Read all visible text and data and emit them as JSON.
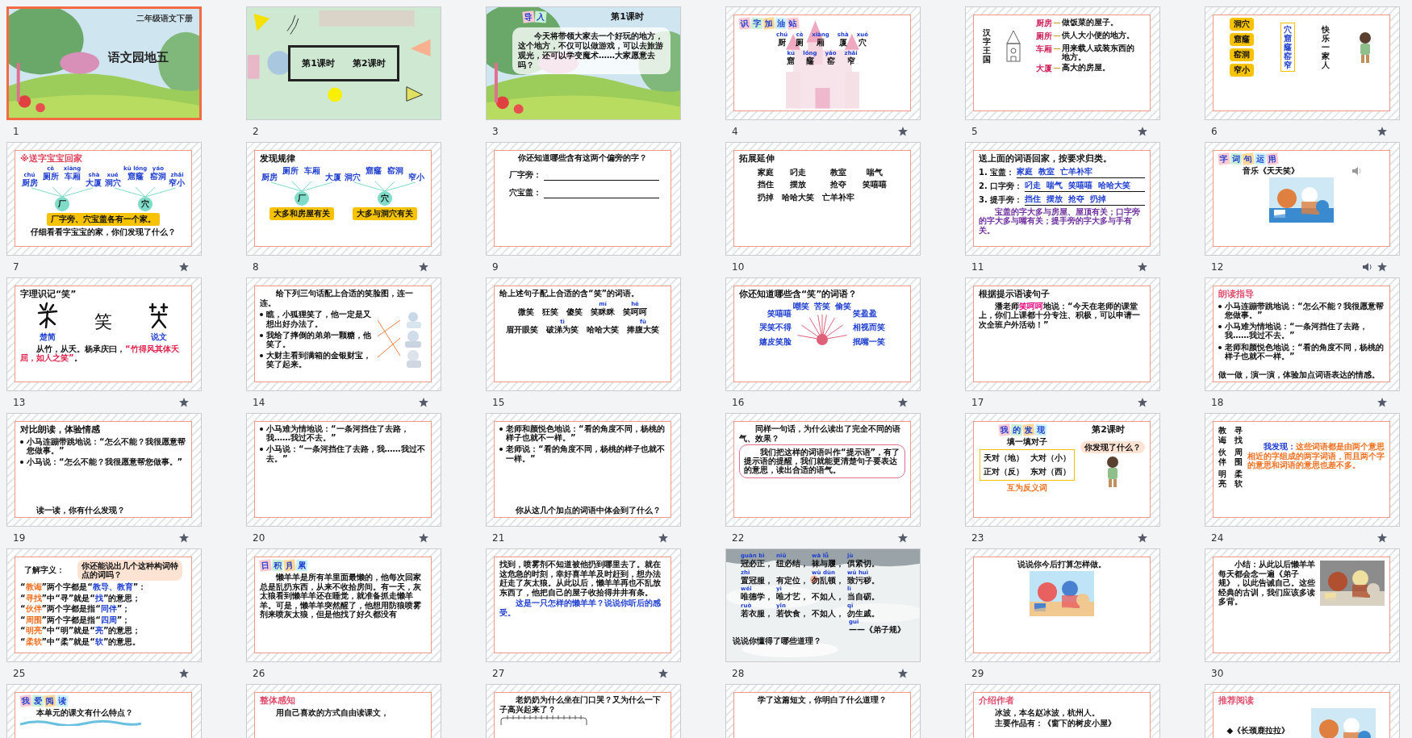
{
  "slides": [
    {
      "number": "1",
      "selected": true,
      "transition": false,
      "audio": false,
      "kind": "landscape",
      "blocks": [
        {
          "kind": "corner",
          "text": "二年级语文下册"
        },
        {
          "kind": "headline",
          "text": "语文园地五"
        }
      ]
    },
    {
      "number": "2",
      "selected": false,
      "transition": false,
      "audio": false,
      "kind": "shapes",
      "blocks": [
        {
          "kind": "lessons",
          "items": [
            "第1课时",
            "第2课时"
          ]
        }
      ]
    },
    {
      "number": "3",
      "selected": false,
      "transition": false,
      "audio": false,
      "kind": "landscape",
      "blocks": [
        {
          "kind": "row",
          "children": [
            {
              "kind": "tag",
              "text": "导入"
            },
            {
              "kind": "title",
              "text": "第1课时"
            }
          ]
        },
        {
          "kind": "panel",
          "text": "今天将带领大家去一个好玩的地方，这个地方，不仅可以做游戏，可以去旅游观光，还可以学变魔术……大家愿意去吗？"
        }
      ]
    },
    {
      "number": "4",
      "selected": false,
      "transition": true,
      "audio": false,
      "kind": "castle",
      "blocks": [
        {
          "kind": "tag",
          "text": "识字加油站"
        },
        {
          "kind": "words",
          "rows": [
            [
              {
                "pinyin": "chú",
                "text": "厨"
              },
              {
                "pinyin": "cè",
                "text": "厕"
              },
              {
                "pinyin": "xiāng",
                "text": "厢"
              },
              {
                "pinyin": "shà",
                "text": "厦"
              },
              {
                "pinyin": "xué",
                "text": "穴"
              }
            ]
          ]
        },
        {
          "kind": "words",
          "rows": [
            [
              {
                "pinyin": "kū",
                "text": "窟"
              },
              {
                "pinyin": "lóng",
                "text": "窿"
              },
              {
                "pinyin": "yáo",
                "text": "窑"
              },
              {
                "pinyin": "zhǎi",
                "text": "窄"
              }
            ]
          ]
        }
      ]
    },
    {
      "number": "5",
      "selected": false,
      "transition": true,
      "audio": false,
      "kind": "framed",
      "blocks": [
        {
          "kind": "row",
          "children": [
            {
              "kind": "vertical",
              "text": "汉字王国"
            },
            {
              "kind": "castle"
            },
            {
              "kind": "gloss",
              "items": [
                {
                  "head": "厨房",
                  "def": "做饭菜的屋子。"
                },
                {
                  "head": "厕所",
                  "def": "供人大小便的地方。"
                },
                {
                  "head": "车厢",
                  "def": "用来载人或装东西的地方。"
                },
                {
                  "head": "大厦",
                  "def": "高大的房屋。"
                }
              ]
            }
          ]
        }
      ]
    },
    {
      "number": "6",
      "selected": false,
      "transition": true,
      "audio": false,
      "kind": "framed",
      "blocks": [
        {
          "kind": "row",
          "children": [
            {
              "kind": "boxes",
              "items": [
                "洞穴",
                "窟窿",
                "窑洞",
                "窄小"
              ]
            },
            {
              "kind": "vbox",
              "text": "穴窟窿窑窄"
            },
            {
              "kind": "vertical",
              "text": "快乐一家人"
            },
            {
              "kind": "figure"
            }
          ]
        }
      ]
    },
    {
      "number": "7",
      "selected": false,
      "transition": true,
      "audio": false,
      "kind": "framed",
      "blocks": [
        {
          "kind": "title",
          "text": "※送字宝宝回家",
          "color": "#e0405a"
        },
        {
          "kind": "hubs",
          "groups": [
            {
              "center": "厂",
              "words": [
                {
                  "pinyin": "chú",
                  "text": "厨房"
                },
                {
                  "pinyin": "cè",
                  "text": "厕所"
                },
                {
                  "pinyin": "xiāng",
                  "text": "车厢"
                },
                {
                  "pinyin": "shà",
                  "text": "大厦"
                }
              ]
            },
            {
              "center": "穴",
              "words": [
                {
                  "pinyin": "xué",
                  "text": "洞穴"
                },
                {
                  "pinyin": "kū lóng",
                  "text": "窟窿"
                },
                {
                  "pinyin": "yáo",
                  "text": "窑洞"
                },
                {
                  "pinyin": "zhǎi",
                  "text": "窄小"
                }
              ]
            }
          ]
        },
        {
          "kind": "banners",
          "items": [
            "厂字旁、穴宝盖各有一个家。"
          ]
        },
        {
          "kind": "center",
          "text": "仔细看看字宝宝的家，你们发现了什么？"
        }
      ]
    },
    {
      "number": "8",
      "selected": false,
      "transition": true,
      "audio": false,
      "kind": "framed",
      "blocks": [
        {
          "kind": "title",
          "text": "发现规律"
        },
        {
          "kind": "hubs",
          "groups": [
            {
              "center": "厂",
              "words": [
                {
                  "text": "厨房"
                },
                {
                  "text": "厕所"
                },
                {
                  "text": "车厢"
                },
                {
                  "text": "大厦"
                }
              ]
            },
            {
              "center": "穴",
              "words": [
                {
                  "text": "洞穴"
                },
                {
                  "text": "窟窿"
                },
                {
                  "text": "窑洞"
                },
                {
                  "text": "窄小"
                }
              ]
            }
          ]
        },
        {
          "kind": "banners",
          "items": [
            "大多和房屋有关",
            "大多与洞穴有关"
          ]
        }
      ]
    },
    {
      "number": "9",
      "selected": false,
      "transition": false,
      "audio": false,
      "kind": "framed",
      "blocks": [
        {
          "kind": "center",
          "text": "你还知道哪些含有这两个偏旁的字？"
        },
        {
          "kind": "fill",
          "items": [
            "厂字旁：",
            "穴宝盖："
          ]
        }
      ]
    },
    {
      "number": "10",
      "selected": false,
      "transition": false,
      "audio": false,
      "kind": "framed",
      "blocks": [
        {
          "kind": "title",
          "text": "拓展延伸"
        },
        {
          "kind": "words",
          "rows": [
            [
              {
                "text": "家庭"
              },
              {
                "text": "叼走"
              },
              {
                "text": "教室"
              },
              {
                "text": "喘气"
              }
            ],
            [
              {
                "text": "挡住"
              },
              {
                "text": "摆放"
              },
              {
                "text": "抢夺"
              },
              {
                "text": "笑嘻嘻"
              }
            ],
            [
              {
                "text": "扔掉"
              },
              {
                "text": "哈哈大笑"
              },
              {
                "text": "亡羊补牢"
              }
            ]
          ]
        }
      ]
    },
    {
      "number": "11",
      "selected": false,
      "transition": true,
      "audio": false,
      "kind": "framed",
      "blocks": [
        {
          "kind": "title",
          "text": "送上面的词语回家，按要求归类。"
        },
        {
          "kind": "dictation",
          "items": [
            {
              "label": "1. 宝盖：",
              "answer": "家庭  教室  亡羊补牢"
            },
            {
              "label": "2. 口字旁：",
              "answer": "叼走  喘气  笑嘻嘻  哈哈大笑"
            },
            {
              "label": "3. 提手旁：",
              "answer": "挡住  摆放  抢夺  扔掉"
            }
          ]
        },
        {
          "kind": "para",
          "text": "宝盖的字大多与房屋、屋顶有关；口字旁的字大多与嘴有关；提手旁的字大多与手有关。",
          "color": "#7030a0"
        }
      ]
    },
    {
      "number": "12",
      "selected": false,
      "transition": true,
      "audio": true,
      "kind": "framed",
      "blocks": [
        {
          "kind": "tag",
          "text": "字词句运用"
        },
        {
          "kind": "row",
          "children": [
            {
              "kind": "line",
              "text": "音乐《天天笑》"
            },
            {
              "kind": "speaker"
            }
          ]
        },
        {
          "kind": "picture"
        }
      ]
    },
    {
      "number": "13",
      "selected": false,
      "transition": true,
      "audio": false,
      "kind": "framed",
      "blocks": [
        {
          "kind": "title",
          "text": "字理识记“笑”"
        },
        {
          "kind": "row",
          "children": [
            {
              "kind": "glyph",
              "caption": "楚简"
            },
            {
              "kind": "big",
              "text": "笑"
            },
            {
              "kind": "glyph",
              "caption": "说文"
            }
          ]
        },
        {
          "kind": "para",
          "segments": [
            {
              "text": "从竹，从夭。杨承庆曰，"
            },
            {
              "text": "“竹得风其体夭屈，如人之笑”",
              "color": "#e0204a"
            },
            {
              "text": "。"
            }
          ]
        }
      ]
    },
    {
      "number": "14",
      "selected": false,
      "transition": true,
      "audio": false,
      "kind": "framed",
      "blocks": [
        {
          "kind": "para",
          "text": "给下列三句话配上合适的笑脸图，连一连。"
        },
        {
          "kind": "row",
          "children": [
            {
              "kind": "bullets",
              "items": [
                "瞧，小狐狸笑了，他一定是又想出好办法了。",
                "我给了摔倒的弟弟一颗糖，他笑了。",
                "大财主看到满箱的金银财宝，笑了起来。"
              ]
            },
            {
              "kind": "match"
            }
          ]
        }
      ]
    },
    {
      "number": "15",
      "selected": false,
      "transition": false,
      "audio": false,
      "kind": "framed",
      "blocks": [
        {
          "kind": "line",
          "text": "给上述句子配上合适的含“笑”的词语。"
        },
        {
          "kind": "words",
          "rows": [
            [
              {
                "text": "微笑"
              },
              {
                "text": "狂笑"
              },
              {
                "text": "傻笑"
              },
              {
                "pinyin": "mī",
                "text": "笑眯眯"
              },
              {
                "pinyin": "hē",
                "text": "笑呵呵"
              }
            ]
          ]
        },
        {
          "kind": "words",
          "rows": [
            [
              {
                "text": "眉开眼笑"
              },
              {
                "pinyin": "tì",
                "text": "破涕为笑"
              },
              {
                "text": "哈哈大笑"
              },
              {
                "pinyin": "fù",
                "text": "捧腹大笑"
              }
            ]
          ]
        }
      ]
    },
    {
      "number": "16",
      "selected": false,
      "transition": true,
      "audio": false,
      "kind": "framed",
      "blocks": [
        {
          "kind": "title",
          "text": "你还知道哪些含“笑”的词语？"
        },
        {
          "kind": "sun",
          "top": [
            "嘲笑",
            "苦笑",
            "偷笑"
          ],
          "left": [
            "笑嘻嘻",
            "哭笑不得",
            "嬉皮笑脸"
          ],
          "right": [
            "笑盈盈",
            "相视而笑",
            "抿嘴一笑"
          ]
        }
      ]
    },
    {
      "number": "17",
      "selected": false,
      "transition": true,
      "audio": false,
      "kind": "framed",
      "blocks": [
        {
          "kind": "title",
          "text": "根据提示语读句子"
        },
        {
          "kind": "para",
          "segments": [
            {
              "text": "潘老师"
            },
            {
              "text": "笑呵呵",
              "color": "#e6007e"
            },
            {
              "text": "地说：“今天在老师的课堂上，你们上课都十分专注、积极，可以申请一次全班户外活动！”"
            }
          ]
        }
      ]
    },
    {
      "number": "18",
      "selected": false,
      "transition": true,
      "audio": false,
      "kind": "framed",
      "blocks": [
        {
          "kind": "title",
          "text": "朗读指导",
          "color": "#e0506e"
        },
        {
          "kind": "bullets",
          "items": [
            "小马连蹦带跳地说：“怎么不能？我很愿意帮您做事。”",
            "小马难为情地说：“一条河挡住了去路，我……我过不去。”",
            "老师和颜悦色地说：“看的角度不同，杨桃的样子也就不一样。”"
          ]
        },
        {
          "kind": "line",
          "text": "做一做，演一演，体验加点词语表达的情感。"
        }
      ]
    },
    {
      "number": "19",
      "selected": false,
      "transition": true,
      "audio": false,
      "kind": "framed",
      "blocks": [
        {
          "kind": "title",
          "text": "对比朗读，体验情感"
        },
        {
          "kind": "bullets",
          "items": [
            "小马连蹦带跳地说：“怎么不能？我很愿意帮您做事。”",
            "小马说：“怎么不能？我很愿意帮您做事。”"
          ]
        },
        {
          "kind": "para",
          "text": "读一读，你有什么发现？"
        }
      ]
    },
    {
      "number": "20",
      "selected": false,
      "transition": true,
      "audio": false,
      "kind": "framed",
      "blocks": [
        {
          "kind": "bullets",
          "items": [
            "小马难为情地说：“一条河挡住了去路，我……我过不去。”",
            "小马说：“一条河挡住了去路，我……我过不去。”"
          ]
        }
      ]
    },
    {
      "number": "21",
      "selected": false,
      "transition": true,
      "audio": false,
      "kind": "framed",
      "blocks": [
        {
          "kind": "bullets",
          "items": [
            "老师和颜悦色地说：“看的角度不同，杨桃的样子也就不一样。”",
            "老师说：“看的角度不同，杨桃的样子也就不一样。”"
          ]
        },
        {
          "kind": "para",
          "text": "你从这几个加点的词语中体会到了什么？"
        }
      ]
    },
    {
      "number": "22",
      "selected": false,
      "transition": true,
      "audio": false,
      "kind": "framed",
      "blocks": [
        {
          "kind": "para",
          "text": "同样一句话，为什么读出了完全不同的语气、效果？"
        },
        {
          "kind": "bubble",
          "text": "我们把这样的词语叫作“提示语”，有了提示语的提醒，我们就能更清楚句子要表达的意思，读出合适的语气。"
        }
      ]
    },
    {
      "number": "23",
      "selected": false,
      "transition": true,
      "audio": false,
      "kind": "framed",
      "blocks": [
        {
          "kind": "row",
          "children": [
            {
              "kind": "tag",
              "text": "我的发现"
            },
            {
              "kind": "title",
              "text": "第2课时"
            }
          ]
        },
        {
          "kind": "row",
          "children": [
            {
              "kind": "stack",
              "children": [
                {
                  "kind": "line",
                  "text": "填一填对子"
                },
                {
                  "kind": "pairs",
                  "items": [
                    "天对（地）",
                    "大对（小）",
                    "正对（反）",
                    "东对（西）"
                  ]
                },
                {
                  "kind": "center",
                  "text": "互为反义词",
                  "color": "#f07020"
                }
              ]
            },
            {
              "kind": "stack",
              "children": [
                {
                  "kind": "callout",
                  "text": "你发现了什么？"
                },
                {
                  "kind": "figure"
                }
              ]
            }
          ]
        }
      ]
    },
    {
      "number": "24",
      "selected": false,
      "transition": true,
      "audio": false,
      "kind": "framed",
      "blocks": [
        {
          "kind": "row",
          "children": [
            {
              "kind": "words",
              "rows": [
                [
                  {
                    "text": "教诲"
                  },
                  {
                    "text": "寻找"
                  }
                ],
                [
                  {
                    "text": "伙伴"
                  },
                  {
                    "text": "周围"
                  }
                ],
                [
                  {
                    "text": "明亮"
                  },
                  {
                    "text": "柔软"
                  }
                ]
              ]
            },
            {
              "kind": "para",
              "segments": [
                {
                  "text": "我发现：",
                  "color": "#1f3fd0"
                },
                {
                  "text": "这些词语都是由两个意思相近的字组成的两字词语，而且两个字的意思和词语的意思也差不多。",
                  "color": "#f07020"
                }
              ]
            }
          ]
        }
      ]
    },
    {
      "number": "25",
      "selected": false,
      "transition": true,
      "audio": false,
      "kind": "framed",
      "blocks": [
        {
          "kind": "row",
          "children": [
            {
              "kind": "line",
              "text": "了解字义："
            },
            {
              "kind": "callout",
              "text": "你还能说出几个这种构词特点的词吗？"
            }
          ]
        },
        {
          "kind": "line",
          "segments": [
            {
              "text": "“"
            },
            {
              "text": "教诲",
              "color": "#f07020"
            },
            {
              "text": "”两个字都是“"
            },
            {
              "text": "教导、教育",
              "color": "#1f3fd0"
            },
            {
              "text": "”："
            }
          ]
        },
        {
          "kind": "line",
          "segments": [
            {
              "text": "“"
            },
            {
              "text": "寻找",
              "color": "#f07020"
            },
            {
              "text": "”中“寻”就是“"
            },
            {
              "text": "找",
              "color": "#1f3fd0"
            },
            {
              "text": "”的意思；"
            }
          ]
        },
        {
          "kind": "line",
          "segments": [
            {
              "text": "“"
            },
            {
              "text": "伙伴",
              "color": "#f07020"
            },
            {
              "text": "”两个字都是指“"
            },
            {
              "text": "同伴",
              "color": "#1f3fd0"
            },
            {
              "text": "”；"
            }
          ]
        },
        {
          "kind": "line",
          "segments": [
            {
              "text": "“"
            },
            {
              "text": "周围",
              "color": "#f07020"
            },
            {
              "text": "”两个字都是指“"
            },
            {
              "text": "四周",
              "color": "#1f3fd0"
            },
            {
              "text": "”；"
            }
          ]
        },
        {
          "kind": "line",
          "segments": [
            {
              "text": "“"
            },
            {
              "text": "明亮",
              "color": "#f07020"
            },
            {
              "text": "”中“明”就是“"
            },
            {
              "text": "亮",
              "color": "#1f3fd0"
            },
            {
              "text": "”的意思；"
            }
          ]
        },
        {
          "kind": "line",
          "segments": [
            {
              "text": "“"
            },
            {
              "text": "柔软",
              "color": "#f07020"
            },
            {
              "text": "”中“柔”就是“"
            },
            {
              "text": "软",
              "color": "#1f3fd0"
            },
            {
              "text": "”的意思。"
            }
          ]
        }
      ]
    },
    {
      "number": "26",
      "selected": false,
      "transition": false,
      "audio": false,
      "kind": "framed",
      "blocks": [
        {
          "kind": "tag",
          "text": "日积月累"
        },
        {
          "kind": "para",
          "text": "懒羊羊是所有羊里面最懒的，他每次回家总是乱扔东西，从来不收拾房间。有一天，灰太狼看到懒羊羊还在睡觉，就准备抓走懒羊羊。可是，懒羊羊突然醒了，他想用防狼喷雾剂来喷灰太狼，但是他找了好久都没有"
        }
      ]
    },
    {
      "number": "27",
      "selected": false,
      "transition": true,
      "audio": false,
      "kind": "framed",
      "blocks": [
        {
          "kind": "line",
          "text": "找到，喷雾剂不知道被他扔到哪里去了。就在这危急的时刻，幸好喜羊羊及时赶到，想办法赶走了灰太狼。从此以后，懒羊羊再也不乱放东西了，他把自己的屋子收拾得井井有条。"
        },
        {
          "kind": "para",
          "text": "这是一只怎样的懒羊羊？说说你听后的感受。",
          "color": "#1f3fd0"
        }
      ]
    },
    {
      "number": "28",
      "selected": false,
      "transition": true,
      "audio": false,
      "kind": "clouds",
      "blocks": [
        {
          "kind": "ruby",
          "phrases": [
            {
              "pinyin": "guān bì",
              "text": "冠必正，"
            },
            {
              "pinyin": "niǔ",
              "text": "纽必结，"
            },
            {
              "pinyin": "wà lǚ",
              "text": "袜与履，"
            },
            {
              "pinyin": "jù",
              "text": "俱紧切。"
            }
          ]
        },
        {
          "kind": "ruby",
          "phrases": [
            {
              "pinyin": "zhì",
              "text": "置冠服，"
            },
            {
              "text": "有定位，"
            },
            {
              "pinyin": "wù dùn",
              "text": "勿乱顿，"
            },
            {
              "pinyin": "wū huì",
              "text": "致污秽。"
            }
          ]
        },
        {
          "kind": "ruby",
          "phrases": [
            {
              "pinyin": "wéi",
              "text": "唯德学，"
            },
            {
              "pinyin": "yì",
              "text": "唯才艺，"
            },
            {
              "text": "不如人，"
            },
            {
              "pinyin": "lì",
              "text": "当自砺。"
            }
          ]
        },
        {
          "kind": "ruby",
          "phrases": [
            {
              "pinyin": "ruò",
              "text": "若衣服，"
            },
            {
              "pinyin": "yǐn",
              "text": "若饮食，"
            },
            {
              "text": "不如人，"
            },
            {
              "pinyin": "qī",
              "text": "勿生戚。"
            }
          ]
        },
        {
          "kind": "ruby",
          "phrases": [
            {
              "pinyin": "guī",
              "text": "——《弟子规》"
            }
          ]
        },
        {
          "kind": "line",
          "text": "说说你懂得了哪些道理？"
        }
      ]
    },
    {
      "number": "29",
      "selected": false,
      "transition": false,
      "audio": false,
      "kind": "framed",
      "blocks": [
        {
          "kind": "center",
          "text": "说说你今后打算怎样做。"
        },
        {
          "kind": "picture"
        }
      ]
    },
    {
      "number": "30",
      "selected": false,
      "transition": false,
      "audio": false,
      "kind": "framed",
      "blocks": [
        {
          "kind": "row",
          "children": [
            {
              "kind": "para",
              "text": "小结：从此以后懒羊羊每天都会念一遍《弟子规》，以此告诫自己。这些经典的古训，我们应该多读多背。"
            },
            {
              "kind": "picture"
            }
          ]
        }
      ]
    },
    {
      "selected": false,
      "kind": "framed",
      "blocks": [
        {
          "kind": "tag",
          "text": "我爱阅读"
        },
        {
          "kind": "para",
          "text": "本单元的课文有什么特点？"
        },
        {
          "kind": "wave"
        }
      ]
    },
    {
      "selected": false,
      "kind": "framed",
      "blocks": [
        {
          "kind": "title",
          "text": "整体感知",
          "color": "#e0506e"
        },
        {
          "kind": "para",
          "text": "用自己喜欢的方式自由读课文，"
        }
      ]
    },
    {
      "selected": false,
      "kind": "framed",
      "blocks": [
        {
          "kind": "para",
          "text": "老奶奶为什么坐在门口哭？又为什么一下子高兴起来了？"
        },
        {
          "kind": "notebook"
        }
      ]
    },
    {
      "selected": false,
      "kind": "framed",
      "blocks": [
        {
          "kind": "center",
          "text": "学了这篇短文，你明白了什么道理？"
        }
      ]
    },
    {
      "selected": false,
      "kind": "framed",
      "blocks": [
        {
          "kind": "title",
          "text": "介绍作者",
          "color": "#e0506e"
        },
        {
          "kind": "para",
          "text": "冰波，本名赵冰波，杭州人。"
        },
        {
          "kind": "para",
          "text": "主要作品有：《窗下的树皮小屋》"
        }
      ]
    },
    {
      "selected": false,
      "kind": "framed",
      "blocks": [
        {
          "kind": "title",
          "text": "推荐阅读",
          "color": "#e0506e"
        },
        {
          "kind": "row",
          "children": [
            {
              "kind": "line",
              "text": "◆《长颈鹿拉拉》"
            },
            {
              "kind": "picture"
            }
          ]
        }
      ]
    }
  ]
}
